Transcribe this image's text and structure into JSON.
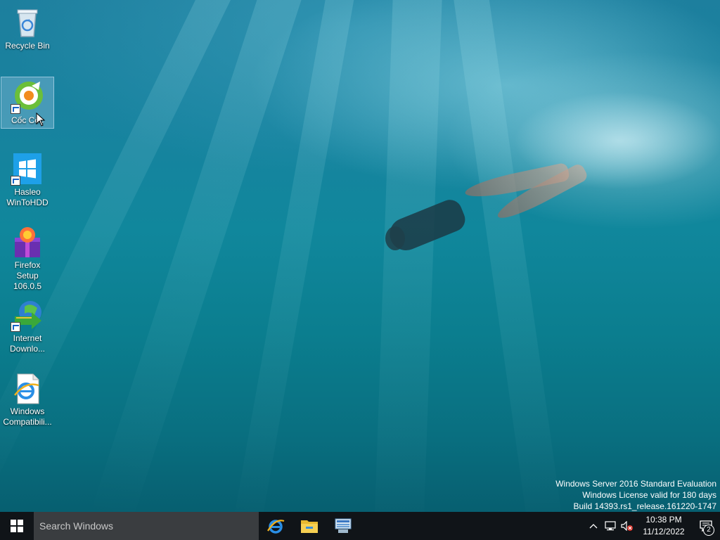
{
  "desktop": {
    "icons": [
      {
        "label": "Recycle Bin"
      },
      {
        "label": "Cốc Cốc"
      },
      {
        "label": "Hasleo WinToHDD"
      },
      {
        "label": "Firefox Setup 106.0.5"
      },
      {
        "label": "Internet Downlo..."
      },
      {
        "label": "Windows Compatibili..."
      }
    ]
  },
  "watermark": {
    "line1": "Windows Server 2016 Standard Evaluation",
    "line2": "Windows License valid for 180 days",
    "line3": "Build 14393.rs1_release.161220-1747"
  },
  "taskbar": {
    "search_placeholder": "Search Windows",
    "pinned": [
      "internet-explorer-icon",
      "file-explorer-icon",
      "server-manager-icon"
    ],
    "clock_time": "10:38 PM",
    "clock_date": "11/12/2022",
    "notification_count": "2"
  },
  "colors": {
    "taskbar": "#101418",
    "search_box": "#3a3d40",
    "wallpaper_mid": "#10879c"
  }
}
